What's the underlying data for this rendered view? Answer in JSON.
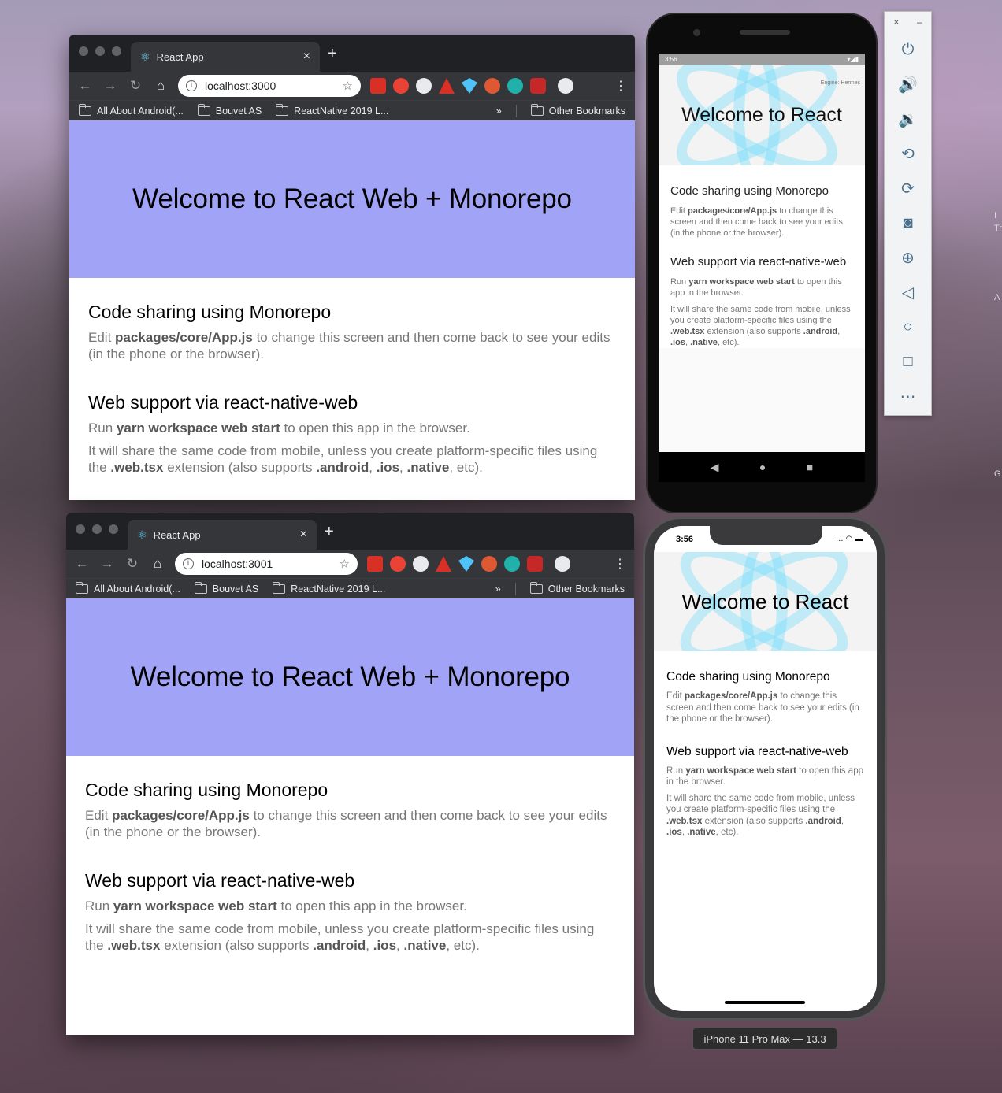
{
  "browser1": {
    "tab_title": "React App",
    "url": "localhost:3000",
    "bookmarks": [
      "All About Android(...",
      "Bouvet AS",
      "ReactNative 2019 L..."
    ],
    "other_bookmarks": "Other Bookmarks"
  },
  "browser2": {
    "tab_title": "React App",
    "url": "localhost:3001",
    "bookmarks": [
      "All About Android(...",
      "Bouvet AS",
      "ReactNative 2019 L..."
    ],
    "other_bookmarks": "Other Bookmarks"
  },
  "web": {
    "hero_title": "Welcome to React Web + Monorepo",
    "section1_title": "Code sharing using Monorepo",
    "section2_title": "Web support via react-native-web"
  },
  "android": {
    "time": "3:56",
    "engine": "Engine: Hermes",
    "hero_title": "Welcome to React",
    "section1_title": "Code sharing using Monorepo",
    "section2_title": "Web support via react-native-web"
  },
  "iphone": {
    "time": "3:56",
    "hero_title": "Welcome to React",
    "section1_title": "Code sharing using Monorepo",
    "section2_title": "Web support via react-native-web",
    "device_label": "iPhone 11 Pro Max — 13.3"
  },
  "text": {
    "edit": "Edit",
    "edit_file": "packages/core/App.js",
    "edit_rest": "to change this screen and then come back to see your edits (in the phone or the browser).",
    "run": "Run",
    "run_cmd": "yarn workspace web start",
    "run_rest": "to open this app in the browser.",
    "share": "It will share the same code from mobile, unless you create platform-specific files using the",
    "share_ext": ".web.tsx",
    "share_mid": "extension (also supports",
    "ext_android": ".android",
    "ext_ios": ".ios",
    "ext_native": ".native",
    "share_end": "etc)."
  },
  "edge_letters": [
    "I",
    "Tr",
    "A",
    "G"
  ],
  "colors": {
    "hero_bg": "#a1a3f7",
    "react_blue": "#61dafb"
  }
}
